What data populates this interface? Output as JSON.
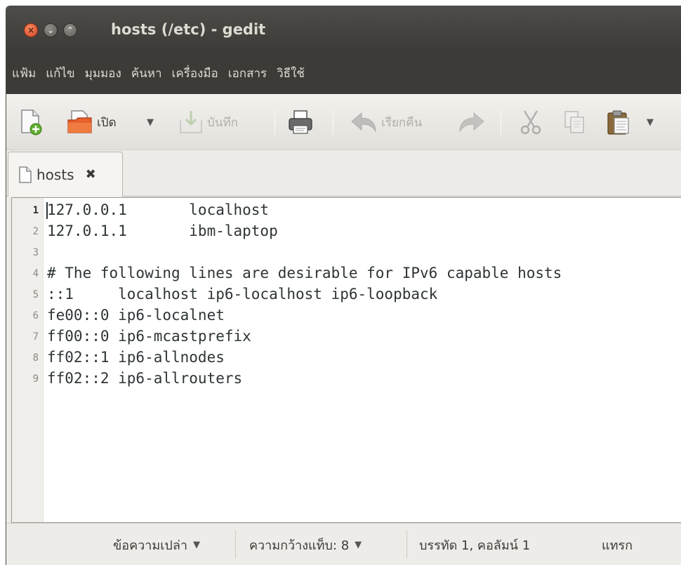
{
  "window": {
    "title": "hosts (/etc) - gedit"
  },
  "menu": [
    "แฟ้ม",
    "แก้ไข",
    "มุมมอง",
    "ค้นหา",
    "เครื่องมือ",
    "เอกสาร",
    "วิธีใช้"
  ],
  "toolbar": {
    "open_label": "เปิด",
    "save_label": "บันทึก",
    "undo_label": "เรียกคืน"
  },
  "tab": {
    "label": "hosts"
  },
  "editor": {
    "lines": [
      {
        "num": "1",
        "text": "127.0.0.1       localhost"
      },
      {
        "num": "2",
        "text": "127.0.1.1       ibm-laptop"
      },
      {
        "num": "3",
        "text": ""
      },
      {
        "num": "4",
        "text": "# The following lines are desirable for IPv6 capable hosts"
      },
      {
        "num": "5",
        "text": "::1     localhost ip6-localhost ip6-loopback"
      },
      {
        "num": "6",
        "text": "fe00::0 ip6-localnet"
      },
      {
        "num": "7",
        "text": "ff00::0 ip6-mcastprefix"
      },
      {
        "num": "8",
        "text": "ff02::1 ip6-allnodes"
      },
      {
        "num": "9",
        "text": "ff02::2 ip6-allrouters"
      }
    ]
  },
  "status": {
    "language": "ข้อความเปล่า",
    "tab_width": "ความกว้างแท็บ: 8",
    "position": "บรรทัด 1, คอลัมน์ 1",
    "mode": "แทรก"
  }
}
